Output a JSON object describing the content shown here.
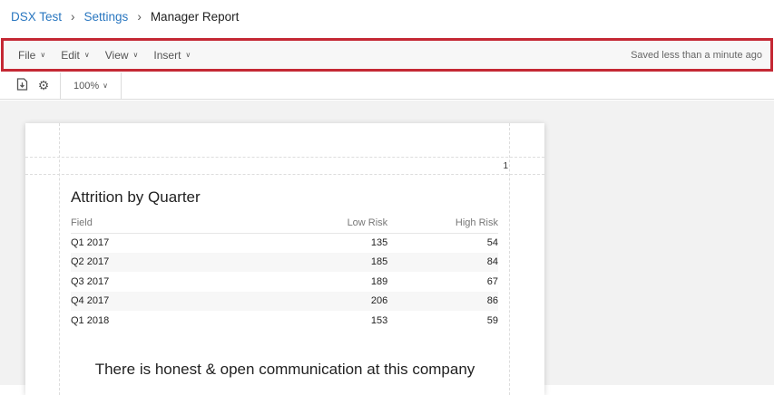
{
  "breadcrumb": {
    "items": [
      "DSX Test",
      "Settings"
    ],
    "current": "Manager Report"
  },
  "menu": {
    "items": [
      "File",
      "Edit",
      "View",
      "Insert"
    ],
    "status": "Saved less than a minute ago"
  },
  "toolbar": {
    "zoom": "100%"
  },
  "page": {
    "number": "1",
    "title": "Attrition by Quarter",
    "columns": [
      "Field",
      "Low Risk",
      "High Risk"
    ],
    "rows": [
      [
        "Q1 2017",
        "135",
        "54"
      ],
      [
        "Q2 2017",
        "185",
        "84"
      ],
      [
        "Q3 2017",
        "189",
        "67"
      ],
      [
        "Q4 2017",
        "206",
        "86"
      ],
      [
        "Q1 2018",
        "153",
        "59"
      ]
    ],
    "next_title": "There is honest & open communication at this company"
  }
}
